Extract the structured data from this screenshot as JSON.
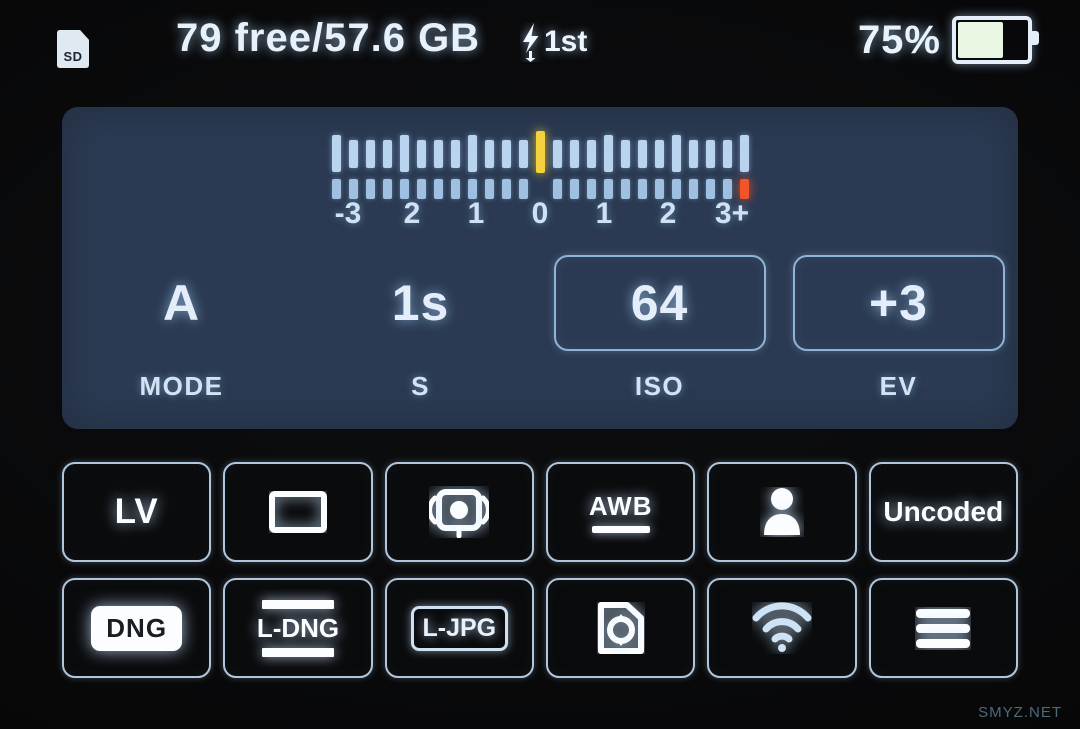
{
  "statusbar": {
    "sd_icon_label": "SD",
    "storage": "79 free/57.6 GB",
    "flash_icon": "flash-bolt-rear-curtain-icon",
    "flash_mode": "1st",
    "battery_percent": "75%",
    "battery_level": 75,
    "battery_fill_color": "#e9f6e2"
  },
  "exposure_panel": {
    "meter": {
      "labels": [
        "-3",
        "2",
        "1",
        "0",
        "1",
        "2",
        "3+"
      ],
      "marker_color": "#f6d13e",
      "warn_color": "#f4542a",
      "tick_color": "#b9d4ef",
      "marker_index": 12,
      "warn_index": 24,
      "tick_count": 25
    },
    "cells": [
      {
        "value": "A",
        "label": "MODE",
        "boxed": false
      },
      {
        "value": "1s",
        "label": "S",
        "boxed": false
      },
      {
        "value": "64",
        "label": "ISO",
        "boxed": true
      },
      {
        "value": "+3",
        "label": "EV",
        "boxed": true
      }
    ],
    "panel_color": "#2b3a52"
  },
  "buttons": [
    {
      "name": "live-view-button",
      "kind": "text",
      "text": "LV"
    },
    {
      "name": "aspect-ratio-button",
      "kind": "rect-icon",
      "text": ""
    },
    {
      "name": "metering-mode-button",
      "kind": "spot-icon",
      "text": ""
    },
    {
      "name": "white-balance-button",
      "kind": "awb",
      "text": "AWB"
    },
    {
      "name": "profile-button",
      "kind": "person-icon",
      "text": ""
    },
    {
      "name": "lens-coding-button",
      "kind": "text-small",
      "text": "Uncoded"
    },
    {
      "name": "dng-format-button",
      "kind": "dng-pill",
      "text": "DNG"
    },
    {
      "name": "large-dng-button",
      "kind": "ldng",
      "text": "L-DNG"
    },
    {
      "name": "large-jpg-button",
      "kind": "ljpg",
      "text": "L-JPG"
    },
    {
      "name": "card-format-button",
      "kind": "card-refresh-icon",
      "text": ""
    },
    {
      "name": "wifi-button",
      "kind": "wifi-icon",
      "text": ""
    },
    {
      "name": "menu-button",
      "kind": "hamburger-icon",
      "text": ""
    }
  ],
  "watermark": "SMYZ.NET"
}
